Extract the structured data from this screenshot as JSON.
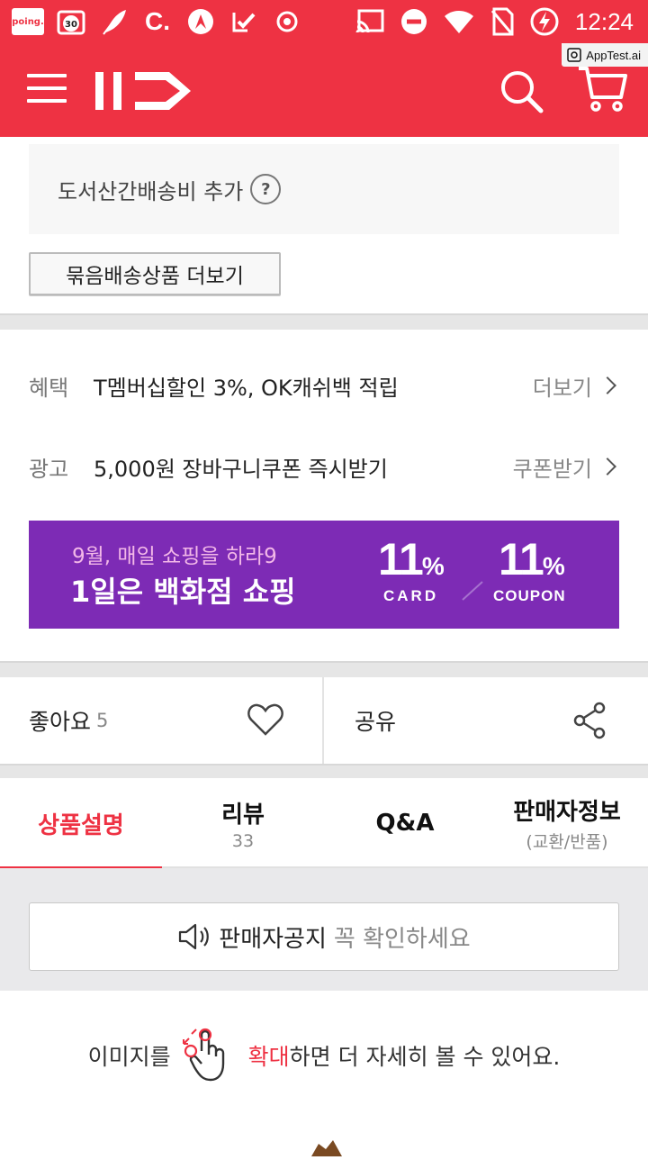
{
  "status_bar": {
    "time": "12:24",
    "left_icons": [
      "poing-app-icon",
      "calendar-30-icon",
      "feather-icon",
      "c-icon",
      "vpn-icon",
      "check-icon",
      "record-icon"
    ],
    "poing_label": "poing.",
    "calendar_day": "30",
    "c_label": "C.",
    "right_icons": [
      "cast-icon",
      "do-not-disturb-icon",
      "wifi-icon",
      "no-sim-icon",
      "battery-charging-icon"
    ]
  },
  "overlay": {
    "apptest_label": "AppTest.ai"
  },
  "app_bar": {
    "background": "#ee3243",
    "logo_text": "11",
    "icons": [
      "menu-icon",
      "search-icon",
      "cart-icon"
    ]
  },
  "shipping": {
    "mountain_fee_label": "도서산간배송비 추가",
    "help_mark": "?",
    "bundle_button": "묶음배송상품 더보기"
  },
  "benefits": {
    "rows": [
      {
        "label": "혜택",
        "value": "T멤버십할인 3%, OK캐쉬백 적립",
        "action": "더보기"
      },
      {
        "label": "광고",
        "value": "5,000원 장바구니쿠폰 즉시받기",
        "action": "쿠폰받기"
      }
    ]
  },
  "banner": {
    "line1": "9월, 매일 쇼핑을 하라9",
    "line2": "1일은 백화점 쇼핑",
    "card_pct": "11",
    "card_pct_sign": "%",
    "card_label": "CARD",
    "coupon_pct": "11",
    "coupon_pct_sign": "%",
    "coupon_label": "COUPON",
    "background": "#7d2bb5"
  },
  "social": {
    "like_label": "좋아요",
    "like_count": "5",
    "share_label": "공유"
  },
  "tabs": [
    {
      "label": "상품설명",
      "sub": "",
      "active": true
    },
    {
      "label": "리뷰",
      "sub": "33",
      "active": false
    },
    {
      "label": "Q&A",
      "sub": "",
      "active": false
    },
    {
      "label": "판매자정보",
      "sub": "(교환/반품)",
      "active": false
    }
  ],
  "notice": {
    "title": "판매자공지",
    "hint": "꼭 확인하세요"
  },
  "zoom_hint": {
    "prefix": "이미지를",
    "highlight": "확대",
    "suffix": "하면 더 자세히 볼 수 있어요."
  }
}
